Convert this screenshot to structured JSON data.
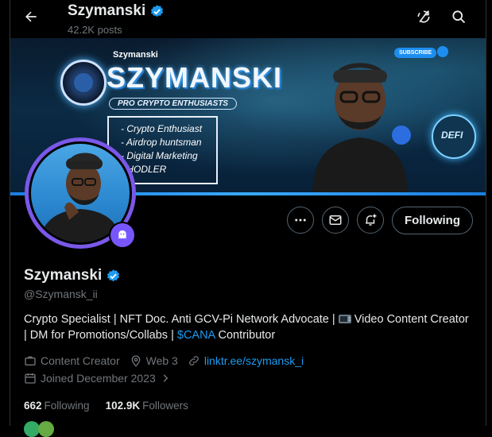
{
  "header": {
    "title": "Szymanski",
    "posts_count": "42.2K posts",
    "back_icon": "arrow-left-icon",
    "right_icons": [
      "refresh-off-icon",
      "search-icon"
    ]
  },
  "banner": {
    "small_name": "Szymanski",
    "big_name": "SZYMANSKI",
    "tagline": "PRO CRYPTO ENTHUSIASTS",
    "list": [
      "- Crypto Enthusiast",
      "- Airdrop huntsman",
      "- Digital Marketing",
      "- HODLER"
    ],
    "subscribe": "SUBSCRIBE",
    "defi_label": "DEFI"
  },
  "actions": {
    "more_icon": "more-dots-icon",
    "message_icon": "envelope-icon",
    "notify_icon": "bell-plus-icon",
    "following_label": "Following"
  },
  "profile": {
    "name": "Szymanski",
    "handle": "@Szymansk_ii",
    "bio_part1": "Crypto Specialist | NFT Doc. Anti GCV-Pi Network Advocate | ",
    "bio_part2": " Video Content Creator | DM for Promotions/Collabs | ",
    "bio_cashtag": "$CANA",
    "bio_part3": " Contributor",
    "category": "Content Creator",
    "location": "Web 3",
    "website": "linktr.ee/szymansk_i",
    "joined": "Joined December 2023"
  },
  "stats": {
    "following_count": "662",
    "following_label": "Following",
    "followers_count": "102.9K",
    "followers_label": "Followers"
  },
  "colors": {
    "accent": "#1d9bf0",
    "verified": "#1d9bf0",
    "avatar_ring": "#7a58e8",
    "muted": "#71767b"
  }
}
